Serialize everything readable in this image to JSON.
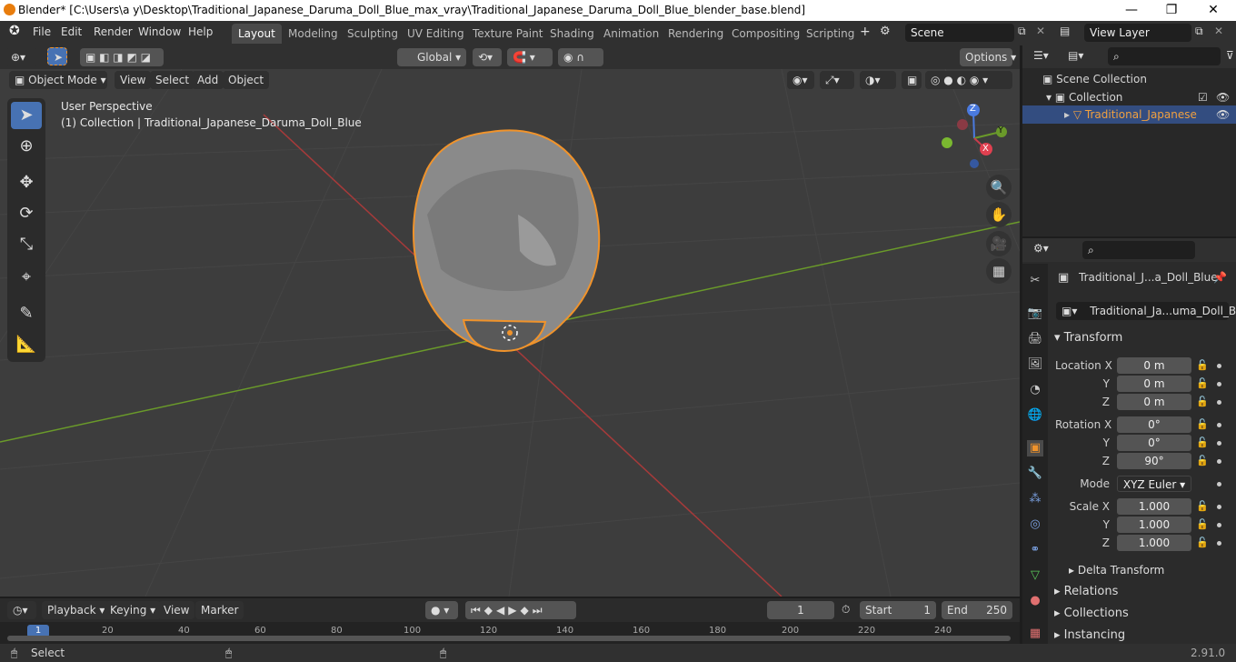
{
  "window": {
    "title": "Blender* [C:\\Users\\a y\\Desktop\\Traditional_Japanese_Daruma_Doll_Blue_max_vray\\Traditional_Japanese_Daruma_Doll_Blue_blender_base.blend]",
    "minimize": "—",
    "maximize": "❐",
    "close": "✕"
  },
  "menus": [
    "File",
    "Edit",
    "Render",
    "Window",
    "Help"
  ],
  "workspaces": [
    "Layout",
    "Modeling",
    "Sculpting",
    "UV Editing",
    "Texture Paint",
    "Shading",
    "Animation",
    "Rendering",
    "Compositing",
    "Scripting"
  ],
  "active_workspace": "Layout",
  "add_workspace": "+",
  "scene": {
    "value": "Scene"
  },
  "view_layer": {
    "value": "View Layer"
  },
  "viewport": {
    "mode": "Object Mode",
    "menu": [
      "View",
      "Select",
      "Add",
      "Object"
    ],
    "transform_orientation": "Global",
    "options": "Options",
    "perspective_label": "User Perspective",
    "collection_label": "(1) Collection | Traditional_Japanese_Daruma_Doll_Blue",
    "gizmo": {
      "x": "X",
      "y": "Y",
      "z": "Z"
    }
  },
  "outliner": {
    "scene_collection": "Scene Collection",
    "collection": "Collection",
    "object": "Traditional_Japanese",
    "search_placeholder": ""
  },
  "properties": {
    "object_name": "Traditional_J...a_Doll_Blue",
    "data_name": "Traditional_Ja...uma_Doll_Blue",
    "transform_label": "Transform",
    "location": {
      "label_x": "Location X",
      "label_y": "Y",
      "label_z": "Z",
      "x": "0 m",
      "y": "0 m",
      "z": "0 m"
    },
    "rotation": {
      "label_x": "Rotation X",
      "label_y": "Y",
      "label_z": "Z",
      "x": "0°",
      "y": "0°",
      "z": "90°"
    },
    "mode": {
      "label": "Mode",
      "value": "XYZ Euler"
    },
    "scale": {
      "label_x": "Scale X",
      "label_y": "Y",
      "label_z": "Z",
      "x": "1.000",
      "y": "1.000",
      "z": "1.000"
    },
    "delta_transform": "Delta Transform",
    "relations": "Relations",
    "collections": "Collections",
    "instancing": "Instancing"
  },
  "timeline": {
    "menu": [
      "Playback",
      "Keying",
      "View",
      "Marker"
    ],
    "current_frame": "1",
    "start_label": "Start",
    "start": "1",
    "end_label": "End",
    "end": "250",
    "ticks": [
      "1",
      "20",
      "40",
      "60",
      "80",
      "100",
      "120",
      "140",
      "160",
      "180",
      "200",
      "220",
      "240"
    ]
  },
  "status": {
    "left": "Select",
    "version": "2.91.0"
  },
  "colors": {
    "accent": "#4772b3",
    "selection_outline": "#f0932b",
    "x_axis": "#a63a3a",
    "y_axis": "#6a9a2a"
  }
}
